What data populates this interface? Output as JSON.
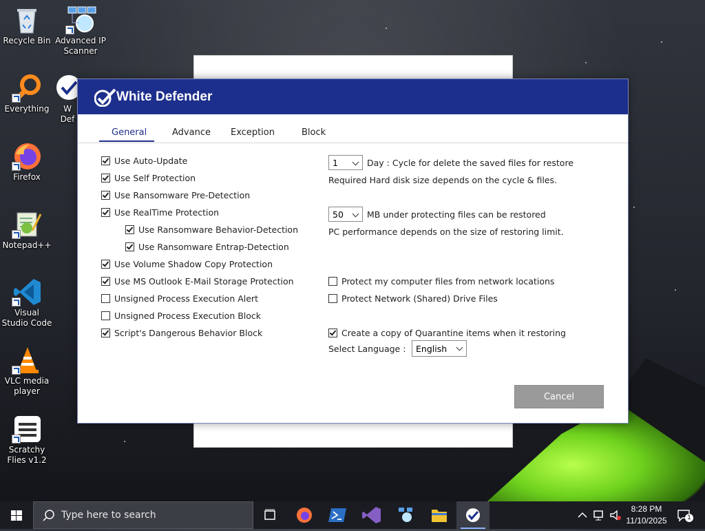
{
  "desktop": {
    "icons": [
      {
        "label": "Recycle Bin",
        "icon": "recycle-bin-icon"
      },
      {
        "label": "Advanced IP Scanner",
        "icon": "network-scanner-icon"
      },
      {
        "label": "Everything",
        "icon": "search-magnifier-icon"
      },
      {
        "label": "W Def",
        "icon": "white-defender-icon"
      },
      {
        "label": "Firefox",
        "icon": "firefox-icon"
      },
      {
        "label": "Notepad++",
        "icon": "notepad-plus-plus-icon"
      },
      {
        "label": "Visual Studio Code",
        "icon": "vscode-icon"
      },
      {
        "label": "VLC media player",
        "icon": "vlc-icon"
      },
      {
        "label": "Scratchy Flies v1.2",
        "icon": "scratchy-flies-icon"
      }
    ]
  },
  "dialog": {
    "title": "White Defender",
    "tabs": [
      "General",
      "Advance",
      "Exception",
      "Block"
    ],
    "active_tab": "General",
    "left_options": [
      {
        "label": "Use Auto-Update",
        "checked": true
      },
      {
        "label": "Use Self Protection",
        "checked": true
      },
      {
        "label": "Use Ransomware Pre-Detection",
        "checked": true
      },
      {
        "label": "Use RealTime Protection",
        "checked": true
      },
      {
        "label": "Use Ransomware Behavior-Detection",
        "checked": true
      },
      {
        "label": "Use Ransomware Entrap-Detection",
        "checked": true
      },
      {
        "label": "Use Volume Shadow Copy Protection",
        "checked": true
      },
      {
        "label": "Use MS Outlook E-Mail Storage Protection",
        "checked": true
      },
      {
        "label": "Unsigned Process Execution Alert",
        "checked": false
      },
      {
        "label": "Unsigned Process Execution Block",
        "checked": false
      },
      {
        "label": "Script's Dangerous Behavior Block",
        "checked": true
      }
    ],
    "cycle_select": "1",
    "cycle_text": "Day : Cycle for delete the saved files for restore",
    "cycle_note": "Required Hard disk size depends on the cycle & files.",
    "size_select": "50",
    "size_text": "MB under protecting files can be restored",
    "size_note": "PC performance depends on the size of restoring limit.",
    "right_options": [
      {
        "label": "Protect my computer files from network locations",
        "checked": false
      },
      {
        "label": "Protect Network (Shared) Drive Files",
        "checked": false
      },
      {
        "label": "Create a copy of Quarantine items when it restoring",
        "checked": true
      }
    ],
    "language_label": "Select Language :",
    "language_value": "English",
    "cancel_label": "Cancel"
  },
  "taskbar": {
    "search_placeholder": "Type here to search",
    "apps": [
      "task-view-icon",
      "firefox-icon",
      "powershell-icon",
      "visual-studio-icon",
      "network-scanner-icon",
      "file-explorer-icon",
      "white-defender-icon"
    ],
    "active_app": "white-defender-icon",
    "time": "8:28 PM",
    "date": "11/10/2025",
    "notification_count": "1"
  },
  "colors": {
    "title_bar": "#1d2f8c",
    "cancel_button": "#9a9a9a"
  }
}
